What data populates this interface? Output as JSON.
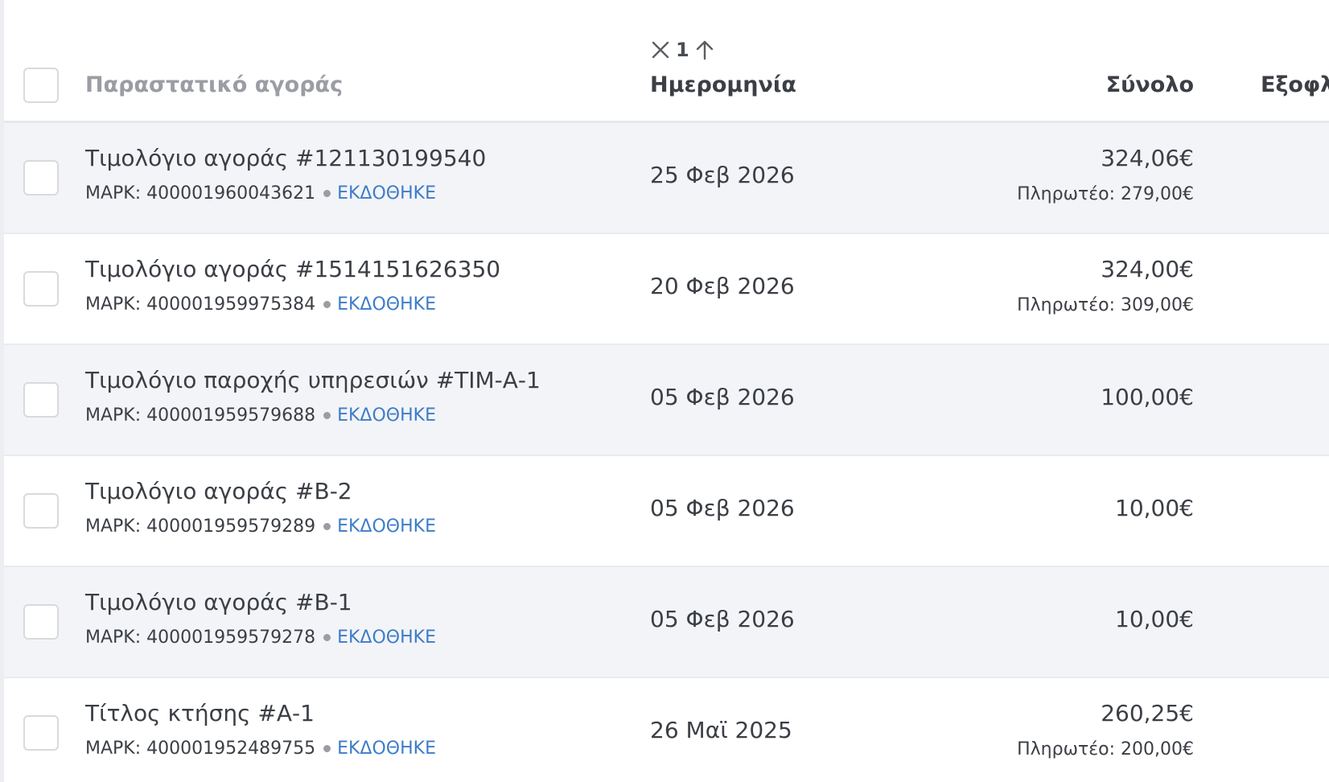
{
  "columns": {
    "document": "Παραστατικό αγοράς",
    "date": "Ημερομηνία",
    "total": "Σύνολο",
    "paid": "Εξοφλ",
    "sort_order": "1"
  },
  "labels": {
    "mark_prefix": "ΜΑΡΚ: ",
    "payable_prefix": "Πληρωτέο: "
  },
  "rows": [
    {
      "title": "Τιμολόγιο αγοράς #121130199540",
      "mark": "400001960043621",
      "status": "ΕΚΔΟΘΗΚΕ",
      "date": "25 Φεβ 2026",
      "total": "324,06€",
      "payable": "279,00€"
    },
    {
      "title": "Τιμολόγιο αγοράς #1514151626350",
      "mark": "400001959975384",
      "status": "ΕΚΔΟΘΗΚΕ",
      "date": "20 Φεβ 2026",
      "total": "324,00€",
      "payable": "309,00€"
    },
    {
      "title": "Τιμολόγιο παροχής υπηρεσιών #ΤΙΜ-Α-1",
      "mark": "400001959579688",
      "status": "ΕΚΔΟΘΗΚΕ",
      "date": "05 Φεβ 2026",
      "total": "100,00€",
      "payable": ""
    },
    {
      "title": "Τιμολόγιο αγοράς #Β-2",
      "mark": "400001959579289",
      "status": "ΕΚΔΟΘΗΚΕ",
      "date": "05 Φεβ 2026",
      "total": "10,00€",
      "payable": ""
    },
    {
      "title": "Τιμολόγιο αγοράς #Β-1",
      "mark": "400001959579278",
      "status": "ΕΚΔΟΘΗΚΕ",
      "date": "05 Φεβ 2026",
      "total": "10,00€",
      "payable": ""
    },
    {
      "title": "Τίτλος κτήσης #Α-1",
      "mark": "400001952489755",
      "status": "ΕΚΔΟΘΗΚΕ",
      "date": "26 Μαϊ 2025",
      "total": "260,25€",
      "payable": "200,00€"
    }
  ],
  "icons": {
    "clear_sort": "close-icon",
    "sort_direction": "arrow-up-icon"
  },
  "colors": {
    "status": "#3d7cc9",
    "row_alt": "#f3f4f7",
    "header_muted": "#9a9da3"
  }
}
